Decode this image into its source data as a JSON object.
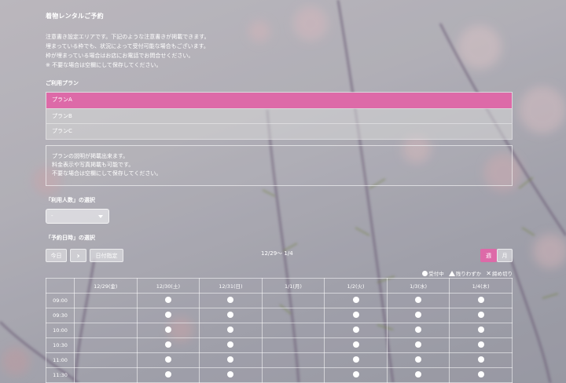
{
  "page": {
    "title": "着物レンタルご予約",
    "notice_lines": [
      "注意書き設定エリアです。下記のような注意書きが掲載できます。",
      "埋まっている枠でも、状況によって受付可能な場合もございます。",
      "枠が埋まっている場合はお店にお電話でお問合せください。",
      "※ 不要な場合は空欄にして保存してください。"
    ]
  },
  "plans": {
    "label": "ご利用プラン",
    "items": [
      "プランA",
      "プランB",
      "プランC"
    ],
    "selected_index": 0
  },
  "description": {
    "lines": [
      "プランの説明が掲載出来ます。",
      "料金表示や写真掲載も可能です。",
      "不要な場合は空欄にして保存してください。"
    ]
  },
  "people": {
    "label": "「利用人数」の選択",
    "selected": "-"
  },
  "date": {
    "label": "「予約日時」の選択",
    "today_button": "今日",
    "next_button": "›",
    "pick_button": "日付指定",
    "range": "12/29〜 1/4",
    "week_button": "週",
    "month_button": "月"
  },
  "legend": {
    "available": "受付中",
    "few": "残りわずか",
    "closed": "締め切り"
  },
  "calendar": {
    "days": [
      "12/29(金)",
      "12/30(土)",
      "12/31(日)",
      "1/1(月)",
      "1/2(火)",
      "1/3(水)",
      "1/4(木)"
    ],
    "times": [
      "09:00",
      "09:30",
      "10:00",
      "10:30",
      "11:00",
      "11:30"
    ],
    "availability": [
      [
        false,
        true,
        true,
        false,
        true,
        true,
        true
      ],
      [
        false,
        true,
        true,
        false,
        true,
        true,
        true
      ],
      [
        false,
        true,
        true,
        false,
        true,
        true,
        true
      ],
      [
        false,
        true,
        true,
        false,
        true,
        true,
        true
      ],
      [
        false,
        true,
        true,
        false,
        true,
        true,
        true
      ],
      [
        false,
        true,
        true,
        false,
        true,
        true,
        true
      ]
    ]
  },
  "colors": {
    "accent": "#dd6aa8",
    "text": "#ffffff"
  }
}
